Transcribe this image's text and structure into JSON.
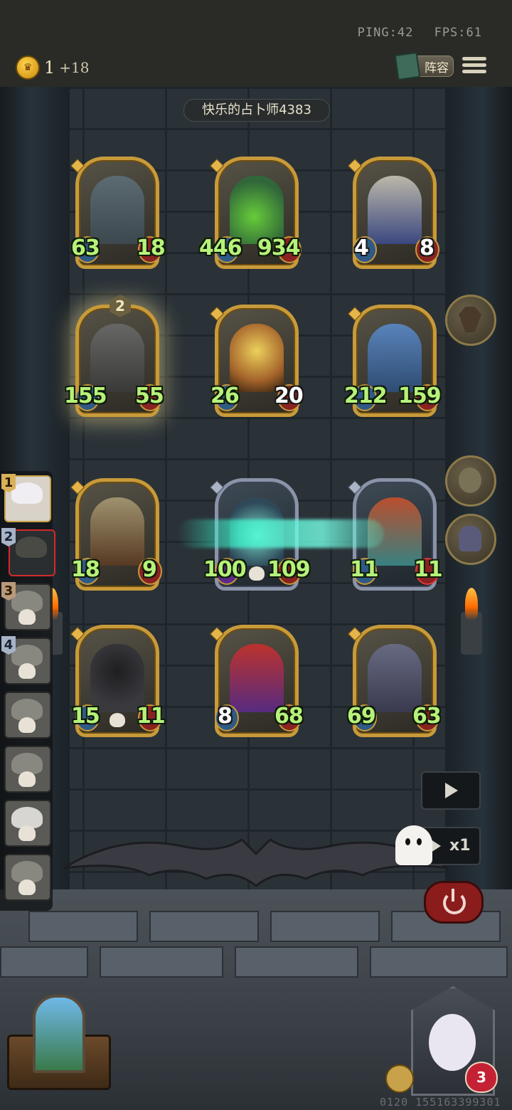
{
  "network": {
    "ping": "PING:42",
    "fps": "FPS:61"
  },
  "gold": {
    "amount": "1",
    "income": "+18"
  },
  "lineup_button": {
    "label": "阵容"
  },
  "opponent": {
    "name": "快乐的占卜师4383"
  },
  "board": {
    "rows": [
      [
        {
          "atk": "63",
          "hp": "18",
          "frame": "gold"
        },
        {
          "atk": "446",
          "hp": "934",
          "frame": "gold"
        },
        {
          "atk": "4",
          "hp": "8",
          "frame": "gold",
          "hp_white": true
        }
      ],
      [
        {
          "atk": "155",
          "hp": "55",
          "frame": "gold",
          "level": "2"
        },
        {
          "atk": "26",
          "hp": "20",
          "frame": "gold",
          "hp_white": true
        },
        {
          "atk": "212",
          "hp": "159",
          "frame": "gold"
        }
      ],
      [
        {
          "atk": "18",
          "hp": "9",
          "frame": "gold"
        },
        {
          "atk": "100",
          "hp": "109",
          "frame": "silver"
        },
        {
          "atk": "11",
          "hp": "11",
          "frame": "silver"
        }
      ],
      [
        {
          "atk": "15",
          "hp": "11",
          "frame": "gold"
        },
        {
          "atk": "8",
          "hp": "68",
          "frame": "gold"
        },
        {
          "atk": "69",
          "hp": "63",
          "frame": "gold"
        }
      ]
    ]
  },
  "queue": {
    "slots": [
      {
        "num": "1"
      },
      {
        "num": "2"
      },
      {
        "num": "3"
      },
      {
        "num": "4"
      },
      {
        "num": ""
      },
      {
        "num": ""
      },
      {
        "num": ""
      },
      {
        "num": ""
      }
    ]
  },
  "controls": {
    "speed": "x1"
  },
  "player": {
    "health": "3"
  },
  "footer": {
    "id": "0120 155163399301"
  },
  "colors": {
    "gold_frame": "#c89a3a",
    "stat_green": "#b6f27a",
    "power_red": "#8a1c1c"
  }
}
